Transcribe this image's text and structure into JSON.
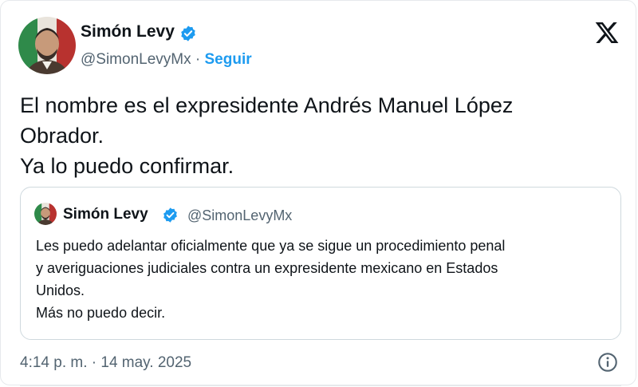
{
  "author": {
    "name": "Simón Levy",
    "handle": "@SimonLevyMx",
    "separator": " · ",
    "follow_label": "Seguir",
    "verified_color": "#1d9bf0"
  },
  "tweet": {
    "lines": [
      "El nombre es el expresidente Andrés Manuel López",
      "Obrador.",
      "Ya lo puedo confirmar."
    ],
    "timestamp": "4:14 p. m. · 14 may. 2025"
  },
  "quoted_tweet": {
    "name": "Simón Levy",
    "handle": "@SimonLevyMx",
    "lines": [
      "Les puedo adelantar oficialmente que ya se sigue un procedimiento penal",
      "y averiguaciones judiciales contra un expresidente mexicano en Estados",
      "Unidos.",
      "Más no puedo decir."
    ]
  },
  "icons": {
    "logo": "x-logo-icon",
    "verified": "verified-badge-icon",
    "info": "info-icon"
  },
  "colors": {
    "text": "#0f1419",
    "secondary": "#536471",
    "accent": "#1d9bf0",
    "border": "#cfd9de"
  }
}
